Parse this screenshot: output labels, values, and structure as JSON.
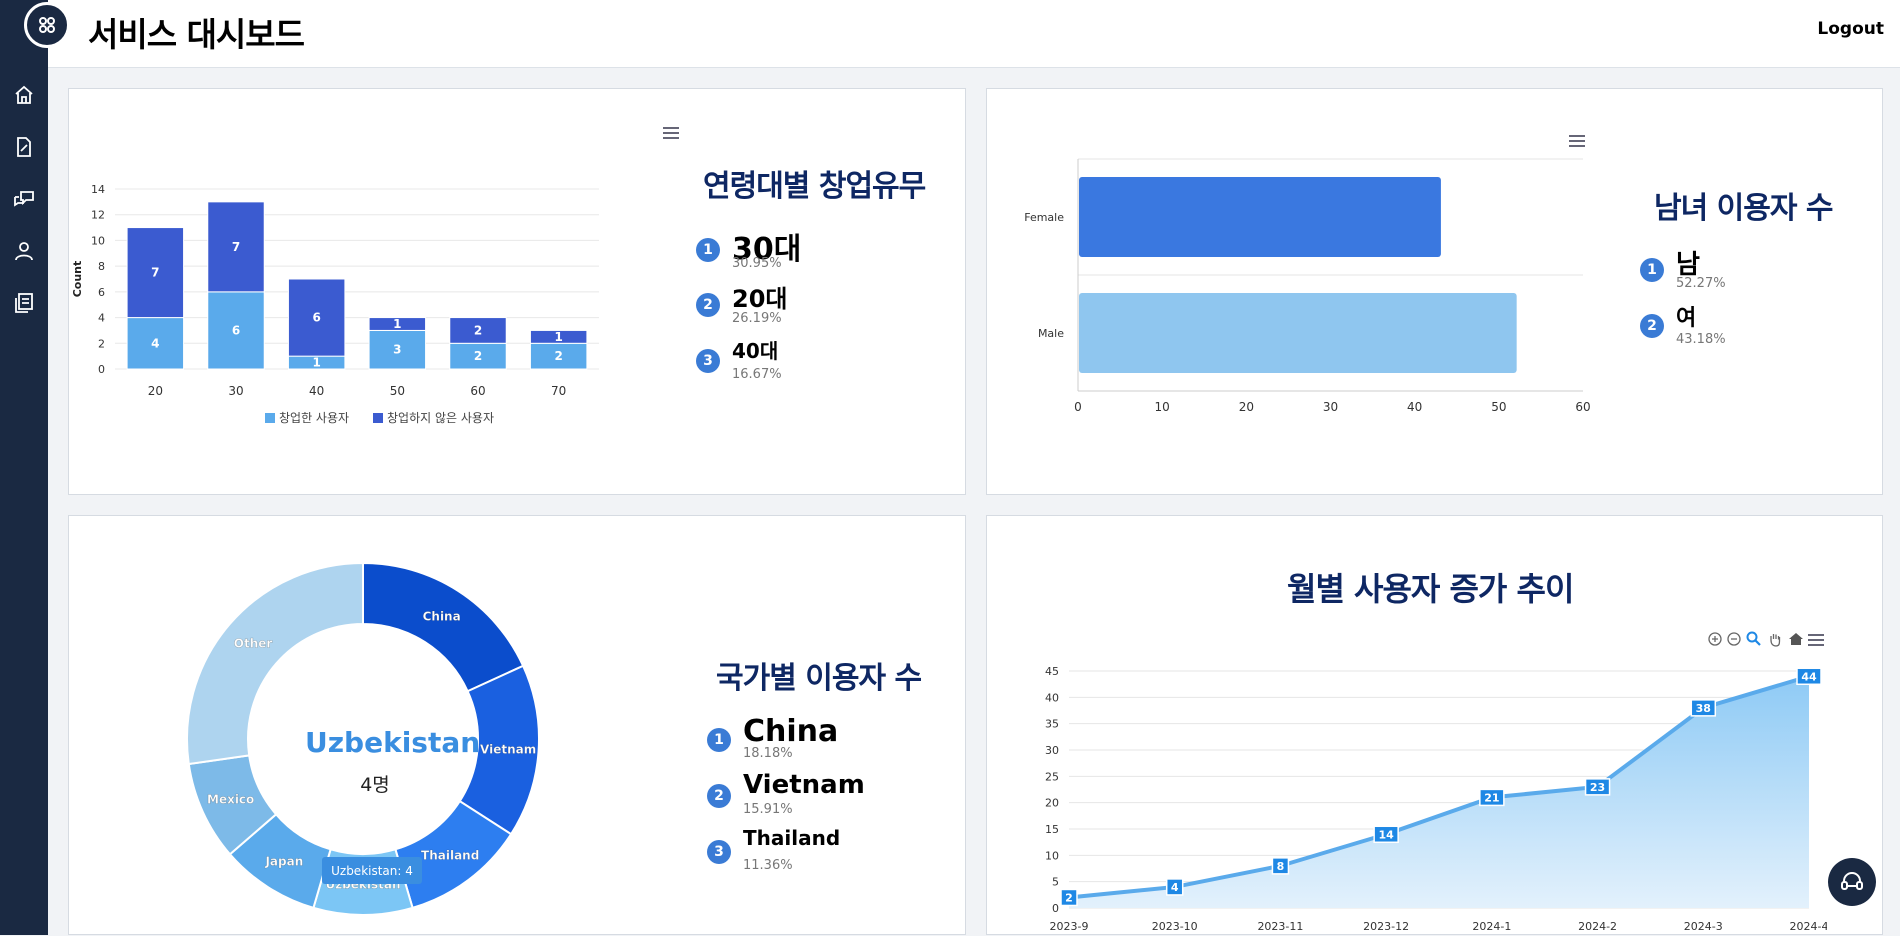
{
  "header": {
    "title": "서비스 대시보드",
    "logout": "Logout"
  },
  "sidebar": {
    "items": [
      {
        "icon": "home-icon"
      },
      {
        "icon": "edit-document-icon"
      },
      {
        "icon": "chat-icon"
      },
      {
        "icon": "user-icon"
      },
      {
        "icon": "board-icon"
      }
    ]
  },
  "age_panel": {
    "title": "연령대별 창업유무",
    "ranks": [
      {
        "num": "1",
        "name": "30대",
        "pct": "30.95%"
      },
      {
        "num": "2",
        "name": "20대",
        "pct": "26.19%"
      },
      {
        "num": "3",
        "name": "40대",
        "pct": "16.67%"
      }
    ]
  },
  "gender_panel": {
    "title": "남녀 이용자 수",
    "ranks": [
      {
        "num": "1",
        "name": "남",
        "pct": "52.27%"
      },
      {
        "num": "2",
        "name": "여",
        "pct": "43.18%"
      }
    ]
  },
  "country_panel": {
    "title": "국가별 이용자 수",
    "center_label": "Uzbekistan",
    "center_value": "4명",
    "tooltip": "Uzbekistan:  4",
    "ranks": [
      {
        "num": "1",
        "name": "China",
        "pct": "18.18%"
      },
      {
        "num": "2",
        "name": "Vietnam",
        "pct": "15.91%"
      },
      {
        "num": "3",
        "name": "Thailand",
        "pct": "11.36%"
      }
    ]
  },
  "monthly_panel": {
    "title": "월별 사용자 증가 추이"
  },
  "colors": {
    "sidebar": "#1a2942",
    "title_navy": "#0e2763",
    "accent": "#3a7bd5"
  },
  "chart_data": [
    {
      "type": "bar",
      "stacked": true,
      "categories": [
        "20",
        "30",
        "40",
        "50",
        "60",
        "70"
      ],
      "series": [
        {
          "name": "창업한 사용자",
          "values": [
            4,
            6,
            1,
            3,
            2,
            2
          ],
          "color": "#5aaaeb"
        },
        {
          "name": "창업하지 않은 사용자",
          "values": [
            7,
            7,
            6,
            1,
            2,
            1
          ],
          "color": "#3b5bd0"
        }
      ],
      "ylabel": "Count",
      "ylim": [
        0,
        14
      ],
      "yticks": [
        0,
        2,
        4,
        6,
        8,
        10,
        12,
        14
      ],
      "legend": "bottom"
    },
    {
      "type": "bar",
      "orientation": "horizontal",
      "categories": [
        "Female",
        "Male"
      ],
      "values": [
        43,
        52
      ],
      "colors": [
        "#3a78e0",
        "#8fc6ef"
      ],
      "xlim": [
        0,
        60
      ],
      "xticks": [
        0,
        10,
        20,
        30,
        40,
        50,
        60
      ]
    },
    {
      "type": "pie",
      "donut": true,
      "labels": [
        "China",
        "Vietnam",
        "Thailand",
        "Uzbekistan",
        "Japan",
        "Mexico",
        "Other"
      ],
      "values": [
        8,
        7,
        5,
        4,
        4,
        4,
        12
      ],
      "colors": [
        "#0b4dcc",
        "#1a60e0",
        "#2d7ef0",
        "#7cc6f5",
        "#5aaaeb",
        "#7dbae8",
        "#aed4ef"
      ]
    },
    {
      "type": "area",
      "categories": [
        "2023-9",
        "2023-10",
        "2023-11",
        "2023-12",
        "2024-1",
        "2024-2",
        "2024-3",
        "2024-4"
      ],
      "values": [
        2,
        4,
        8,
        14,
        21,
        23,
        38,
        44
      ],
      "ylim": [
        0,
        45
      ],
      "yticks": [
        0,
        5,
        10,
        15,
        20,
        25,
        30,
        35,
        40,
        45
      ],
      "color": "#5aaaeb"
    }
  ]
}
